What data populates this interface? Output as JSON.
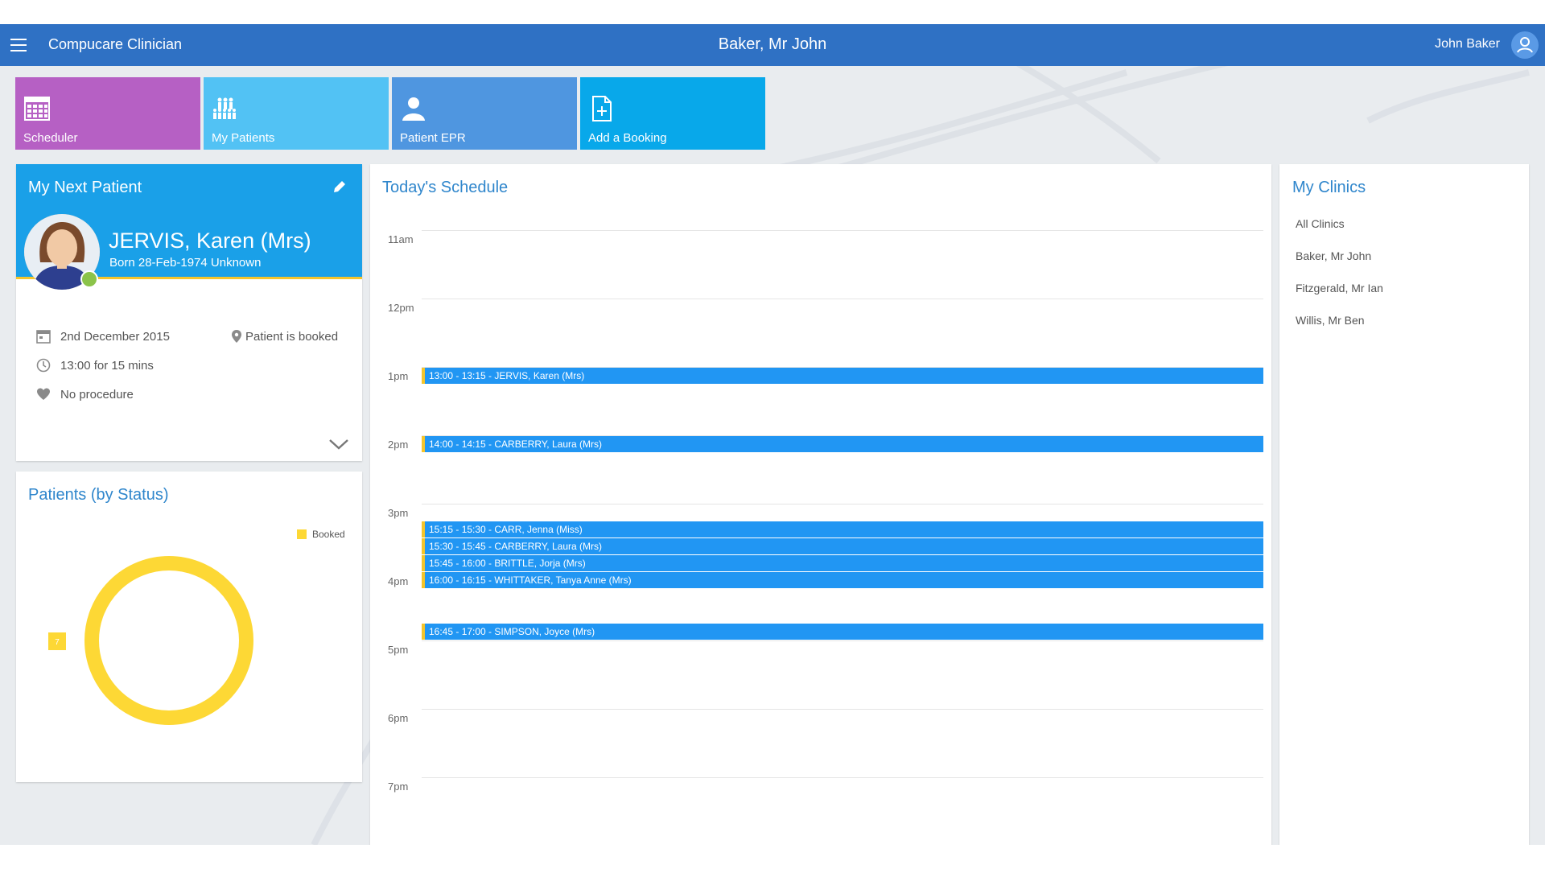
{
  "header": {
    "app_title": "Compucare Clinician",
    "current_patient": "Baker, Mr John",
    "user_name": "John Baker"
  },
  "tiles": [
    {
      "label": "Scheduler",
      "icon": "calendar-grid-icon",
      "color": "#b660c4"
    },
    {
      "label": "My Patients",
      "icon": "people-group-icon",
      "color": "#52c2f4"
    },
    {
      "label": "Patient EPR",
      "icon": "person-icon",
      "color": "#4f96e0"
    },
    {
      "label": "Add a Booking",
      "icon": "add-document-icon",
      "color": "#08a8ea"
    }
  ],
  "next_patient": {
    "title": "My Next Patient",
    "name": "JERVIS, Karen (Mrs)",
    "born": "Born 28-Feb-1974  Unknown",
    "date": "2nd December 2015",
    "time": "13:00 for 15 mins",
    "procedure": "No procedure",
    "status": "Patient is booked"
  },
  "patients_by_status": {
    "title": "Patients (by Status)",
    "legend_booked": "Booked",
    "booked_count_label": "7"
  },
  "chart_data": {
    "type": "pie",
    "title": "Patients (by Status)",
    "categories": [
      "Booked"
    ],
    "values": [
      7
    ],
    "colors": [
      "#fdd835"
    ],
    "legend": "top-right"
  },
  "schedule": {
    "title": "Today's Schedule",
    "hours": [
      "11am",
      "12pm",
      "1pm",
      "2pm",
      "3pm",
      "4pm",
      "5pm",
      "6pm",
      "7pm"
    ],
    "appointments": [
      "13:00 - 13:15 - JERVIS, Karen (Mrs)",
      "14:00 - 14:15 - CARBERRY, Laura (Mrs)",
      "15:15 - 15:30 - CARR, Jenna (Miss)",
      "15:30 - 15:45 - CARBERRY, Laura (Mrs)",
      "15:45 - 16:00 - BRITTLE, Jorja (Mrs)",
      "16:00 - 16:15 - WHITTAKER, Tanya Anne (Mrs)",
      "16:45 - 17:00 - SIMPSON, Joyce (Mrs)"
    ]
  },
  "clinics": {
    "title": "My Clinics",
    "items": [
      "All Clinics",
      "Baker, Mr John",
      "Fitzgerald, Mr Ian",
      "Willis, Mr Ben"
    ]
  }
}
